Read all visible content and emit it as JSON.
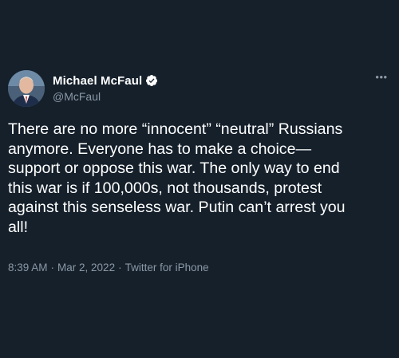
{
  "author": {
    "display_name": "Michael McFaul",
    "handle": "@McFaul",
    "verified": true,
    "avatar_icon": "profile-photo"
  },
  "menu": {
    "icon": "more-options-icon",
    "glyph": "•••"
  },
  "tweet": {
    "text": "There are no more “innocent” “neutral” Russians\nanymore. Everyone has to make a choice—\nsupport or oppose this war. The only way to end\nthis war is if 100,000s, not thousands, protest\nagainst this senseless war. Putin can’t arrest you\nall!"
  },
  "meta": {
    "time": "8:39 AM",
    "separator": "·",
    "date": "Mar 2, 2022",
    "source": "Twitter for iPhone"
  },
  "colors": {
    "background": "#15202b",
    "text": "#ffffff",
    "secondary": "#8b98a5",
    "verified_badge": "#ffffff"
  }
}
